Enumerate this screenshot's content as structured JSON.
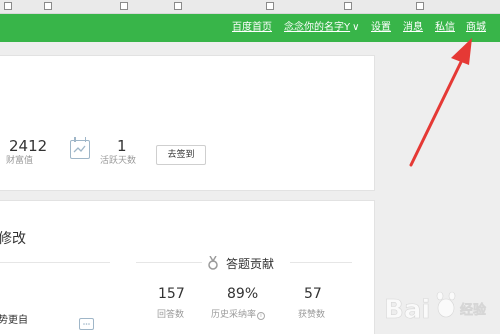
{
  "topnav": {
    "items": [
      "百度首页",
      "念念你的名字Y",
      "设置",
      "消息",
      "私信",
      "商城"
    ],
    "bg": "#38b549"
  },
  "profile": {
    "wealth_value": "2412",
    "wealth_label": "财富值",
    "active_value": "1",
    "active_label": "活跃天数",
    "signin_button": "去签到"
  },
  "section2": {
    "title_fragment": "修改",
    "contrib_title": "答题贡献",
    "left_fragment": "势更自",
    "stats": [
      {
        "value": "157",
        "label": "回答数"
      },
      {
        "value": "89%",
        "label": "历史采纳率"
      },
      {
        "value": "57",
        "label": "获赞数"
      }
    ]
  },
  "annotation": {
    "arrow_color": "#e53935"
  }
}
